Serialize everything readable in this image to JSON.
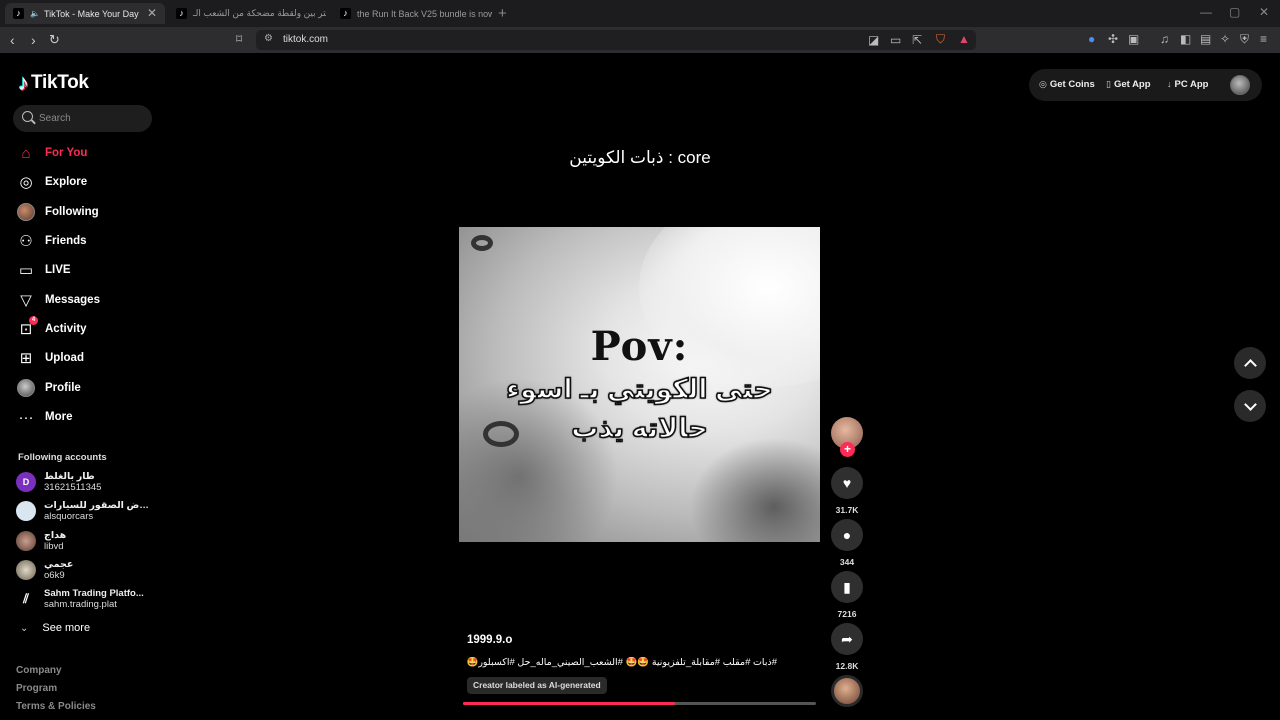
{
  "browser": {
    "tabs": [
      {
        "title": "TikTok - Make Your Day",
        "active": true
      },
      {
        "title": "مستر بين ولقطة مضحكة من الشعب الـ",
        "active": false
      },
      {
        "title": "the Run It Back V25 bundle is now av",
        "active": false
      }
    ],
    "url": "tiktok.com",
    "new_tab_icon": "+",
    "window_controls": [
      "—",
      "▢",
      "✕"
    ]
  },
  "tiktok": {
    "brand": "TikTok",
    "search_placeholder": "Search",
    "nav": [
      {
        "label": "For You",
        "icon": "home-icon",
        "active": true
      },
      {
        "label": "Explore",
        "icon": "compass-icon"
      },
      {
        "label": "Following",
        "icon": "following-avatar-icon"
      },
      {
        "label": "Friends",
        "icon": "friends-icon"
      },
      {
        "label": "LIVE",
        "icon": "live-tv-icon"
      },
      {
        "label": "Messages",
        "icon": "messages-icon"
      },
      {
        "label": "Activity",
        "icon": "activity-icon",
        "badge": "4"
      },
      {
        "label": "Upload",
        "icon": "upload-icon"
      },
      {
        "label": "Profile",
        "icon": "profile-icon"
      },
      {
        "label": "More",
        "icon": "more-dots-icon"
      }
    ],
    "following_title": "Following accounts",
    "following_accounts": [
      {
        "name": "طار بالغلط",
        "username": "31621511345",
        "avatar_letter": "D",
        "avatar_color": "#7b2fbe"
      },
      {
        "name": "معرض الصقور للسيارات",
        "username": "alsquorcars",
        "avatar_color": "#d9e6ef"
      },
      {
        "name": "هداج",
        "username": "libvd",
        "avatar_color": "#8a6a5a"
      },
      {
        "name": "عجمي",
        "username": "o6k9",
        "avatar_color": "#c9c0b0"
      },
      {
        "name": "Sahm Trading Platfo...",
        "username": "sahm.trading.plat",
        "avatar_color": "#000000"
      }
    ],
    "see_more": "See more",
    "footer_links": [
      "Company",
      "Program",
      "Terms & Policies"
    ],
    "top_actions": {
      "get_coins": "Get Coins",
      "get_app": "Get App",
      "pc_app": "PC App"
    },
    "video": {
      "title": "ذبات الكويتين : core",
      "overlay_pov": "Pov:",
      "overlay_line1": "حتى الكويتي بـ اسوء",
      "overlay_line2": "حالاته يذب",
      "author": "1999.9.o",
      "caption": "#ذبات #مقلب #مقابلة_تلفزيونية 🤩🤩 #الشعب_الصيني_ماله_حل #اكسبلور🤩",
      "ai_label": "Creator labeled as AI-generated",
      "progress": 0.6
    },
    "actions": {
      "likes": "31.7K",
      "comments": "344",
      "saves": "7216",
      "shares": "12.8K"
    }
  },
  "colors": {
    "accent": "#fe2c55",
    "background": "#000000"
  }
}
